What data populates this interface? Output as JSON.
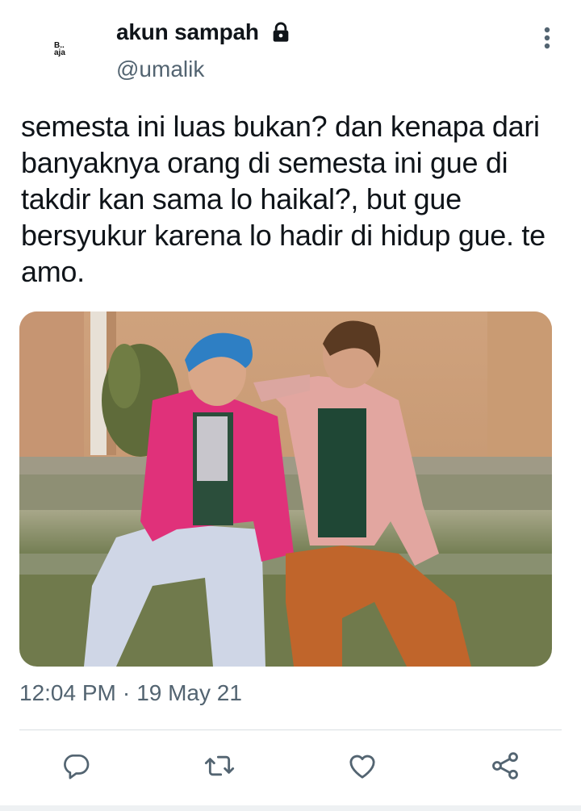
{
  "author": {
    "display_name": "akun sampah",
    "handle": "@umalik",
    "avatar_text": "B..\naja",
    "protected_icon": "lock-icon"
  },
  "tweet": {
    "text": "semesta ini luas bukan? dan kenapa dari banyaknya orang di semesta ini gue di takdir kan sama lo haikal?, but gue bersyukur karena lo hadir di hidup gue. te amo.",
    "time": "12:04 PM",
    "separator": "·",
    "date": "19 May 21"
  },
  "actions": [
    {
      "name": "reply",
      "icon": "comment-icon"
    },
    {
      "name": "retweet",
      "icon": "retweet-icon"
    },
    {
      "name": "like",
      "icon": "heart-icon"
    },
    {
      "name": "share",
      "icon": "share-icon"
    }
  ],
  "colors": {
    "text": "#0f1419",
    "secondary": "#536471",
    "divider": "#d9dfe3"
  }
}
